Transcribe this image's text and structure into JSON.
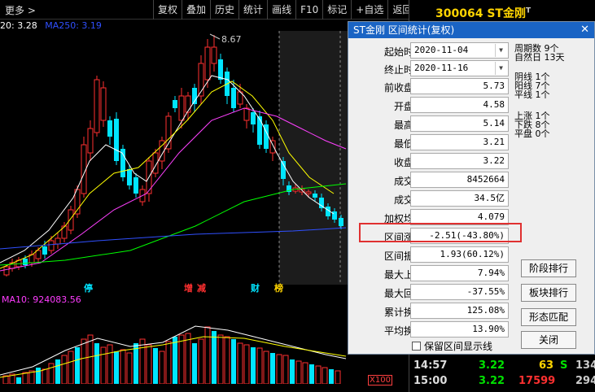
{
  "toolbar": {
    "more": "更多 >",
    "menu": [
      "复权",
      "叠加",
      "历史",
      "统计",
      "画线",
      "F10",
      "标记",
      "+自选",
      "返回"
    ]
  },
  "stock": {
    "code_name": "300064 ST金刚",
    "marker": "T"
  },
  "indicators": {
    "ma_line": "20: 3.28",
    "ma250": "MA250: 3.19",
    "vol_ma10": "MA10: 924083.56"
  },
  "chart": {
    "high_label": "8.67",
    "events": [
      "停",
      "增",
      "减",
      "财",
      "榜"
    ],
    "x_scale": "X100"
  },
  "ticks": [
    {
      "time": "14:57",
      "price": "3.22",
      "vol": "63",
      "flag": "S",
      "amt": "134"
    },
    {
      "time": "15:00",
      "price": "3.22",
      "vol": "17599",
      "flag": "",
      "amt": "294"
    }
  ],
  "dialog": {
    "title": "ST金刚 区间统计(复权)",
    "close": "✕",
    "start_label": "起始时间",
    "start_value": "2020-11-04",
    "end_label": "终止时间",
    "end_value": "2020-11-16",
    "rows": [
      {
        "label": "前收盘价",
        "value": "5.73"
      },
      {
        "label": "开盘价",
        "value": "4.58"
      },
      {
        "label": "最高价",
        "value": "5.14"
      },
      {
        "label": "最低价",
        "value": "3.21"
      },
      {
        "label": "收盘价",
        "value": "3.22"
      },
      {
        "label": "成交量",
        "value": "8452664"
      },
      {
        "label": "成交额",
        "value": "34.5亿"
      },
      {
        "label": "加权均价",
        "value": "4.079"
      },
      {
        "label": "区间涨幅",
        "value": "-2.51(-43.80%)"
      },
      {
        "label": "区间振幅",
        "value": "1.93(60.12%)"
      },
      {
        "label": "最大上涨",
        "value": "7.94%"
      },
      {
        "label": "最大回撤",
        "value": "-37.55%"
      },
      {
        "label": "累计换手",
        "value": "125.08%"
      },
      {
        "label": "平均换手",
        "value": "13.90%"
      }
    ],
    "period": {
      "l1": "周期数",
      "v1": "9个",
      "l2": "自然日",
      "v2": "13天"
    },
    "counts": {
      "l1": "阴线",
      "v1": "1个",
      "l2": "阳线",
      "v2": "7个",
      "l3": "平线",
      "v3": "1个"
    },
    "updown": {
      "l1": "上涨",
      "v1": "1个",
      "l2": "下跌",
      "v2": "8个",
      "l3": "平盘",
      "v3": "0个"
    },
    "buttons": [
      "阶段排行",
      "板块排行",
      "形态匹配",
      "关闭"
    ],
    "checkbox": "保留区间显示线"
  },
  "colors": {
    "up": "#ff3030",
    "down": "#00e5ff",
    "ma5": "#ffffff",
    "ma10": "#ffff00",
    "ma20": "#ff40ff",
    "ma60": "#00ff00",
    "ma250": "#3050ff",
    "highlight": "#e03030",
    "titlebar": "#1a64c4"
  }
}
